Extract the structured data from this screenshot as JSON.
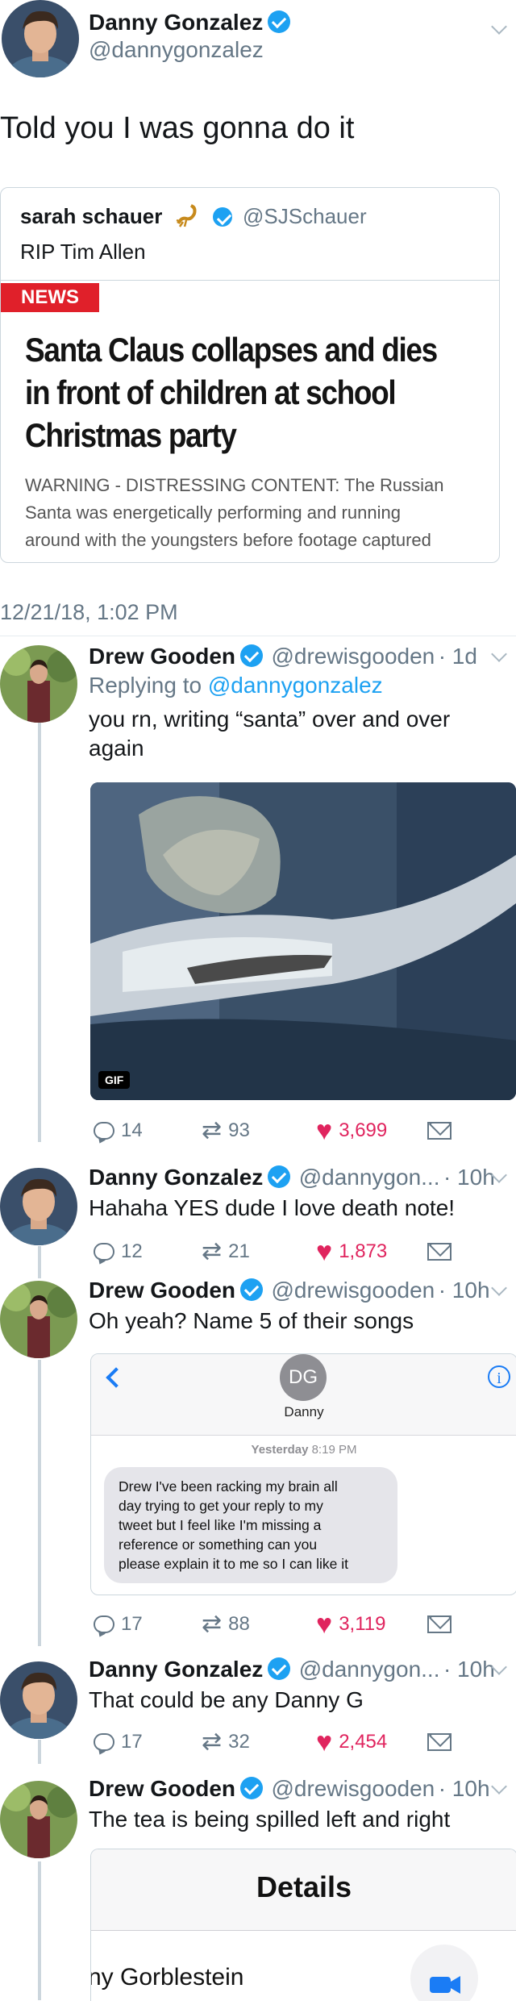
{
  "main_tweet": {
    "name": "Danny Gonzalez",
    "handle": "@dannygonzalez",
    "text": "Told you I was gonna do it",
    "timestamp": "12/21/18, 1:02 PM",
    "quoted": {
      "name": "sarah schauer",
      "handle": "@SJSchauer",
      "text": "RIP Tim Allen",
      "card": {
        "badge": "NEWS",
        "headline_1": "Santa Claus collapses and dies",
        "headline_2": "in front of children at school",
        "headline_3": "Christmas party",
        "summary_1": "WARNING - DISTRESSING CONTENT: The Russian",
        "summary_2": "Santa was energetically performing and running",
        "summary_3": "around with the youngsters before footage captured"
      }
    }
  },
  "replies": [
    {
      "name": "Drew Gooden",
      "handle": "@drewisgooden",
      "time": "· 1d",
      "replying_label": "Replying to",
      "replying_handle": "@dannygonzalez",
      "text_1": "you rn, writing “santa” over and over",
      "text_2": "again",
      "gif_label": "GIF",
      "replies_count": "14",
      "retweets": "93",
      "likes": "3,699"
    },
    {
      "name": "Danny Gonzalez",
      "handle": "@dannygon...",
      "time": "· 10h",
      "text": "Hahaha YES dude I love death note!",
      "replies_count": "12",
      "retweets": "21",
      "likes": "1,873"
    },
    {
      "name": "Drew Gooden",
      "handle": "@drewisgooden",
      "time": "· 10h",
      "text": "Oh yeah? Name 5 of their songs",
      "imessage": {
        "initials": "DG",
        "contact": "Danny",
        "stamp_day": "Yesterday",
        "stamp_time": "8:19 PM",
        "bubble_1": "Drew I've been racking my brain all",
        "bubble_2": "day trying to get your reply to my",
        "bubble_3": "tweet but I feel like I'm missing a",
        "bubble_4": "reference or something can you",
        "bubble_5": "please explain it to me so I can like it"
      },
      "replies_count": "17",
      "retweets": "88",
      "likes": "3,119"
    },
    {
      "name": "Danny Gonzalez",
      "handle": "@dannygon...",
      "time": "· 10h",
      "text": "That could be any Danny G",
      "replies_count": "17",
      "retweets": "32",
      "likes": "2,454"
    },
    {
      "name": "Drew Gooden",
      "handle": "@drewisgooden",
      "time": "· 10h",
      "text": "The tea is being spilled left and right",
      "details": {
        "title": "Details",
        "contact_partial": "ny Gorblestein"
      }
    }
  ],
  "colors": {
    "accent": "#1da1f2",
    "like": "#e0245e",
    "news_red": "#e0202a",
    "muted": "#657786"
  }
}
